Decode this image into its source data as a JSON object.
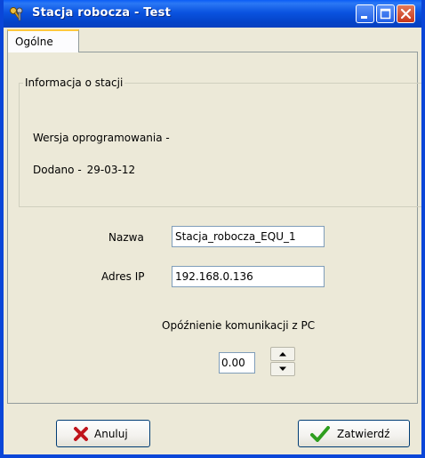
{
  "window": {
    "title": "Stacja robocza - Test",
    "icon": "keys-icon"
  },
  "tabs": [
    {
      "label": "Ogólne",
      "active": true
    }
  ],
  "group": {
    "title": "Informacja o stacji",
    "version_label": "Wersja oprogramowania -",
    "added_label": "Dodano -",
    "added_value": "29-03-12"
  },
  "form": {
    "name_label": "Nazwa",
    "name_value": "Stacja_robocza_EQU_1",
    "ip_label": "Adres IP",
    "ip_value": "192.168.0.136",
    "delay_label": "Opóźnienie komunikacji z PC",
    "delay_value": "0.00"
  },
  "buttons": {
    "cancel_label": "Anuluj",
    "ok_label": "Zatwierdź"
  },
  "colors": {
    "titlebar": "#0a53e0",
    "cancel_icon": "#c0141c",
    "ok_icon": "#2e9e1e"
  }
}
